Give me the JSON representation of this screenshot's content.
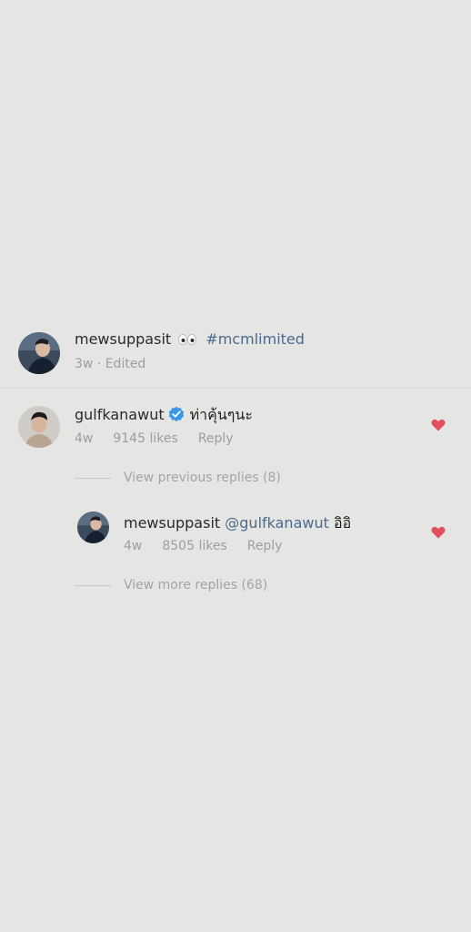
{
  "caption": {
    "username": "mewsuppasit",
    "hashtag": "#mcmlimited",
    "meta": "3w · Edited",
    "emoji": "eyes-emoji"
  },
  "comment": {
    "username": "gulfkanawut",
    "text": "ท่าคุ้นๆนะ",
    "time": "4w",
    "likes": "9145 likes",
    "reply_label": "Reply",
    "verified": true,
    "liked": true
  },
  "view_previous": "View previous replies (8)",
  "reply": {
    "username": "mewsuppasit",
    "mention": "@gulfkanawut",
    "text": "อิอิ",
    "time": "4w",
    "likes": "8505 likes",
    "reply_label": "Reply",
    "liked": true
  },
  "view_more": "View more replies (68)",
  "colors": {
    "background": "#e5e5e4",
    "link": "#4a6a8e",
    "heart": "#e2505f",
    "verified": "#3a97e8",
    "muted": "#9e9e9e"
  }
}
